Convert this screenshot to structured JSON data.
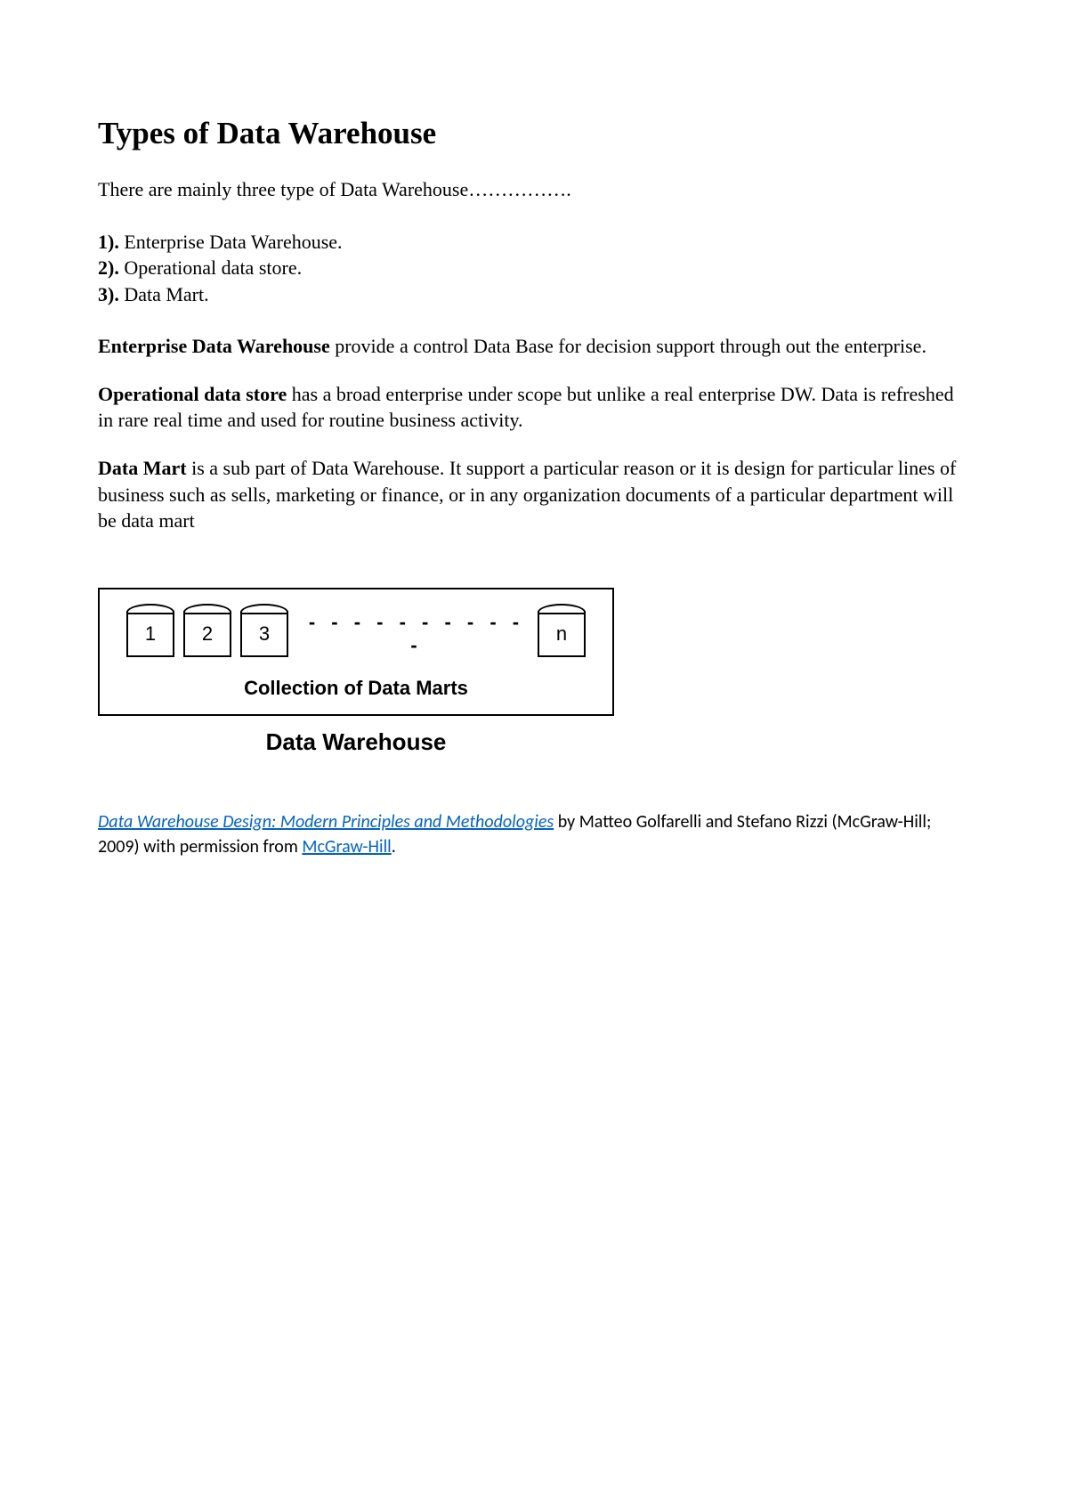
{
  "heading": "Types of Data Warehouse",
  "intro": "There are mainly three type of Data Warehouse…………….",
  "list": {
    "n1": "1).",
    "i1": " Enterprise Data Warehouse.",
    "n2": "2).",
    "i2": " Operational data store.",
    "n3": "3).",
    "i3": " Data Mart."
  },
  "para1": {
    "term": "Enterprise Data Warehouse",
    "rest": " provide a control Data Base for decision support through out the enterprise."
  },
  "para2": {
    "term": "Operational data store",
    "rest": " has a broad enterprise under scope but unlike a real enterprise DW. Data is refreshed in rare real time and used for routine business activity."
  },
  "para3": {
    "term": "Data Mart",
    "rest": " is a sub part of Data Warehouse. It support a particular reason or it is design for particular lines of business such as sells, marketing or finance, or in any organization documents of a particular department will be data mart"
  },
  "diagram": {
    "marts": [
      "1",
      "2",
      "3"
    ],
    "dots": "- - - - - - - - - - -",
    "last": "n",
    "collection_label": "Collection of Data Marts",
    "title": "Data Warehouse"
  },
  "citation": {
    "book_link": "Data Warehouse Design: Modern Principles and Methodologies",
    "mid1": " by Matteo Golfarelli and Stefano Rizzi (McGraw-Hill; 2009) with permission from ",
    "pub_link": "McGraw-Hill",
    "end": "."
  }
}
